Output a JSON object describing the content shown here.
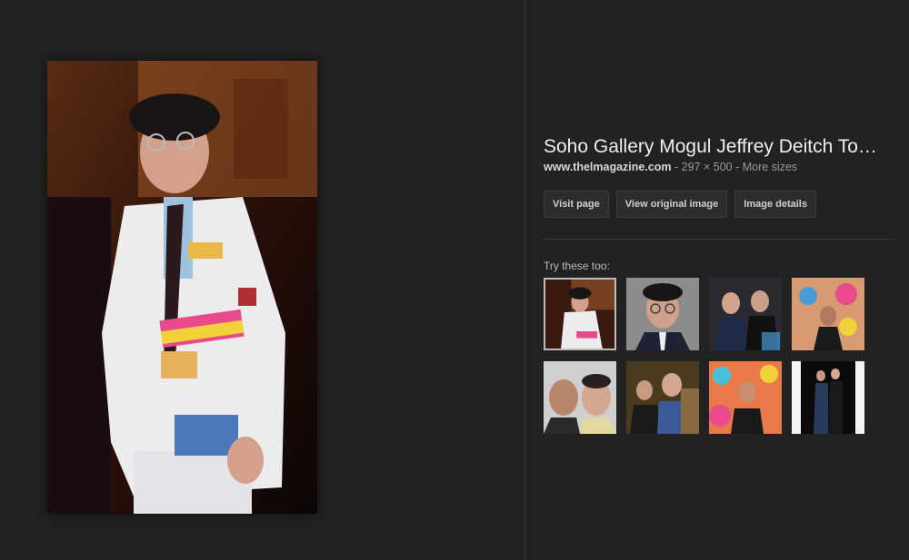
{
  "result": {
    "title": "Soho Gallery Mogul Jeffrey Deitch To…",
    "domain": "www.thelmagazine.com",
    "separator": " - ",
    "dimensions": "297 × 500",
    "more_sizes": "More sizes"
  },
  "actions": {
    "visit_page": "Visit page",
    "view_original": "View original image",
    "image_details": "Image details"
  },
  "related": {
    "label": "Try these too:"
  }
}
